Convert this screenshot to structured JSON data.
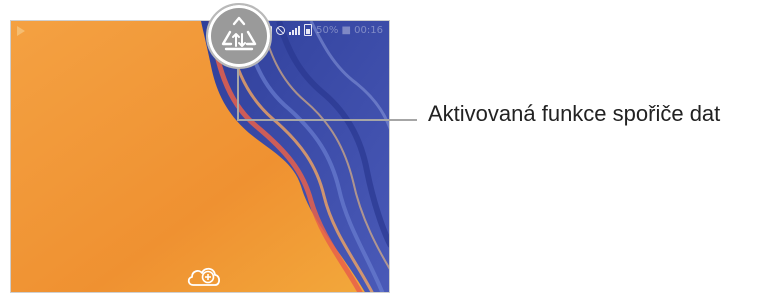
{
  "callout": {
    "label": "Aktivovaná funkce spořiče dat",
    "badge_icon": "data-saver-icon"
  },
  "status_bar": {
    "left_icon": "play-notification-icon",
    "right_icons": [
      "sim-icon",
      "blocked-icon",
      "signal-icon",
      "battery-icon"
    ],
    "faded_text": "50% ■ 00:16"
  },
  "home_screen": {
    "center_icon": "cloud-add-icon"
  },
  "colors": {
    "wallpaper_orange": "#f19a34",
    "wallpaper_blue": "#3b4fa6",
    "leader_line": "#a6a6a6",
    "badge_gray": "#9a9a9a"
  }
}
